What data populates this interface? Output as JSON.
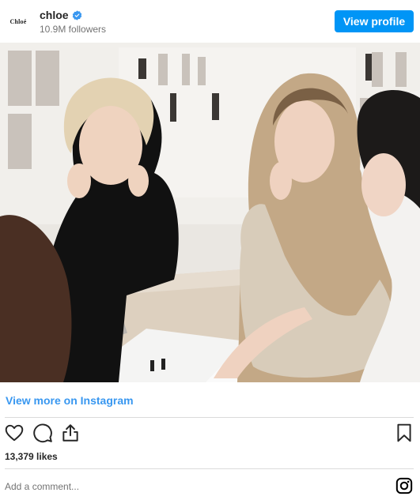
{
  "header": {
    "avatar_text": "Chloé",
    "username": "chloe",
    "followers": "10.9M followers",
    "view_profile_label": "View profile",
    "verified_icon": "verified-badge-icon"
  },
  "post": {
    "view_more_label": "View more on Instagram",
    "likes": "13,379 likes",
    "comment_placeholder": "Add a comment..."
  },
  "icons": {
    "like": "heart-icon",
    "comment": "comment-icon",
    "share": "share-icon",
    "save": "bookmark-icon",
    "instagram": "instagram-icon"
  },
  "colors": {
    "accent": "#0095f6",
    "link": "#3897f0",
    "text": "#262626",
    "muted": "#737373",
    "divider": "#dbdbdb"
  }
}
